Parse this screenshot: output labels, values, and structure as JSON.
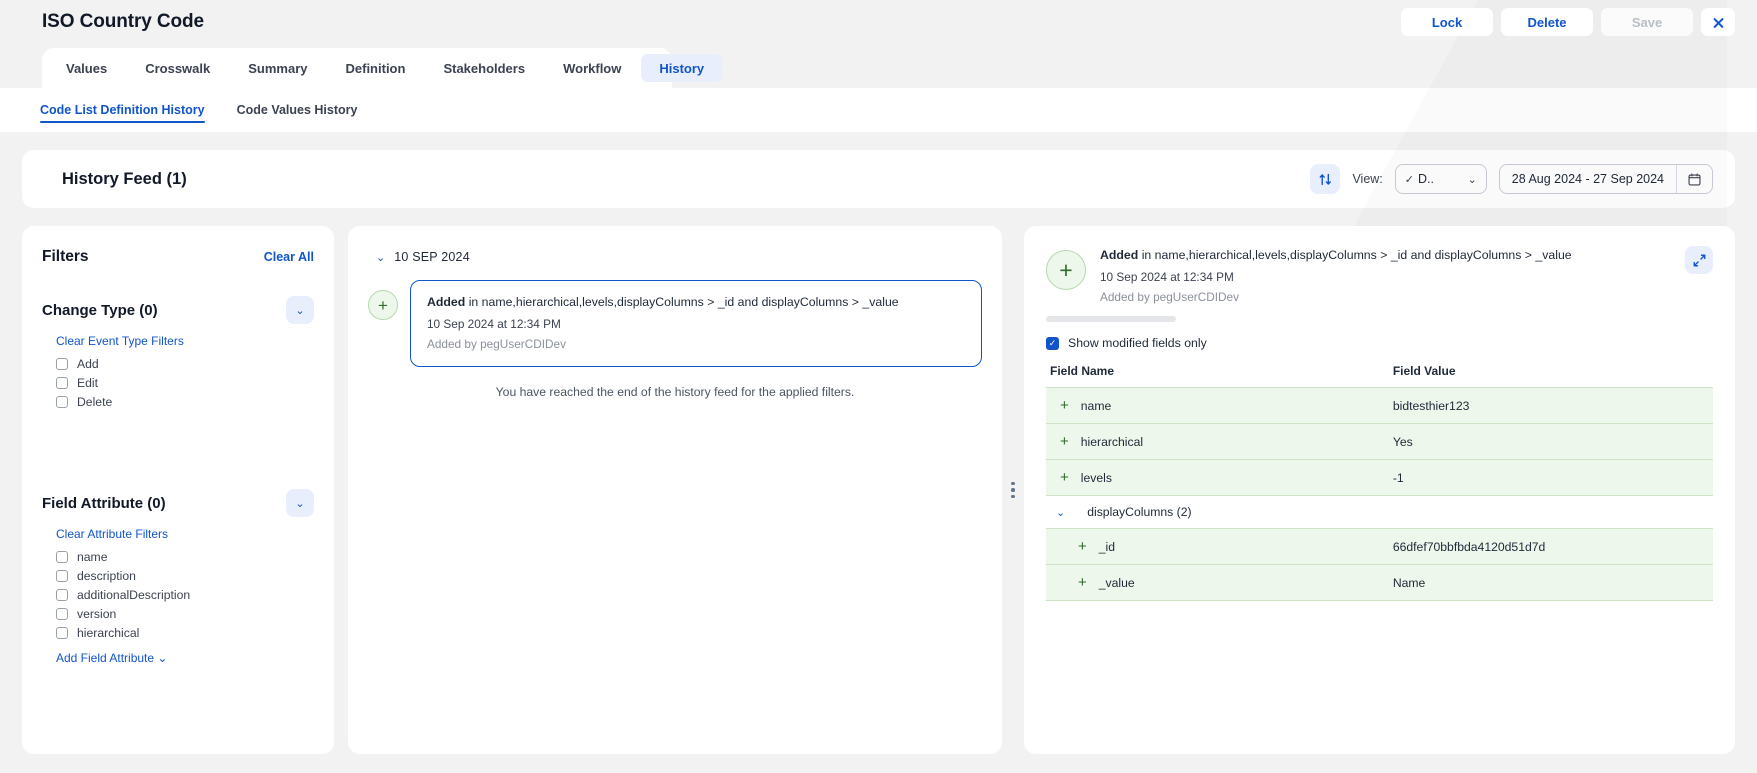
{
  "header": {
    "title": "ISO Country Code",
    "actions": [
      {
        "label": "Lock",
        "name": "lock-button",
        "state": "enabled"
      },
      {
        "label": "Delete",
        "name": "delete-button",
        "state": "enabled"
      },
      {
        "label": "Save",
        "name": "save-button",
        "state": "disabled"
      }
    ],
    "close_icon": "close-icon"
  },
  "tabs": [
    {
      "label": "Values",
      "active": false
    },
    {
      "label": "Crosswalk",
      "active": false
    },
    {
      "label": "Summary",
      "active": false
    },
    {
      "label": "Definition",
      "active": false
    },
    {
      "label": "Stakeholders",
      "active": false
    },
    {
      "label": "Workflow",
      "active": false
    },
    {
      "label": "History",
      "active": true
    }
  ],
  "subtabs": [
    {
      "label": "Code List Definition History",
      "active": true
    },
    {
      "label": "Code Values History",
      "active": false
    }
  ],
  "feed_header": {
    "title": "History Feed (1)",
    "sort_icon": "sort-arrows-icon",
    "view_label": "View:",
    "view_value": "D..",
    "view_check": "✓",
    "date_range": "28 Aug 2024 - 27 Sep 2024",
    "calendar_icon": "calendar-icon"
  },
  "filters": {
    "title": "Filters",
    "clear_all": "Clear All",
    "groups": [
      {
        "title": "Change Type (0)",
        "clear_link": "Clear Event Type Filters",
        "options": [
          {
            "label": "Add",
            "checked": false
          },
          {
            "label": "Edit",
            "checked": false
          },
          {
            "label": "Delete",
            "checked": false
          }
        ]
      },
      {
        "title": "Field Attribute (0)",
        "clear_link": "Clear Attribute Filters",
        "options": [
          {
            "label": "name",
            "checked": false
          },
          {
            "label": "description",
            "checked": false
          },
          {
            "label": "additionalDescription",
            "checked": false
          },
          {
            "label": "version",
            "checked": false
          },
          {
            "label": "hierarchical",
            "checked": false
          }
        ],
        "add_link": "Add Field Attribute"
      }
    ]
  },
  "feed": {
    "date_group": "10 SEP 2024",
    "event": {
      "badge_icon": "plus-icon",
      "action": "Added",
      "description": "in name,hierarchical,levels,displayColumns > _id and displayColumns > _value",
      "timestamp": "10 Sep 2024 at 12:34 PM",
      "author": "Added by pegUserCDIDev"
    },
    "end_message": "You have reached the end of the history feed for the applied filters."
  },
  "detail": {
    "badge_icon": "plus-icon",
    "action": "Added",
    "description": "in name,hierarchical,levels,displayColumns > _id and displayColumns > _value",
    "timestamp": "10 Sep 2024 at 12:34 PM",
    "author": "Added by pegUserCDIDev",
    "expand_icon": "expand-icon",
    "show_modified_label": "Show modified fields only",
    "show_modified_checked": true,
    "columns": {
      "name": "Field Name",
      "value": "Field Value"
    },
    "rows": [
      {
        "kind": "field",
        "name": "name",
        "value": "bidtesthier123",
        "nested": false
      },
      {
        "kind": "field",
        "name": "hierarchical",
        "value": "Yes",
        "nested": false
      },
      {
        "kind": "field",
        "name": "levels",
        "value": "-1",
        "nested": false
      },
      {
        "kind": "group",
        "name": "displayColumns (2)",
        "value": ""
      },
      {
        "kind": "field",
        "name": "_id",
        "value": "66dfef70bbfbda4120d51d7d",
        "nested": true
      },
      {
        "kind": "field",
        "name": "_value",
        "value": "Name",
        "nested": true
      }
    ]
  },
  "colors": {
    "accent": "#1155cc",
    "accent_soft": "#e8eefc",
    "added_row": "#eef7ec",
    "added_border": "#b7d9ae",
    "added_text": "#2f6b2a"
  }
}
